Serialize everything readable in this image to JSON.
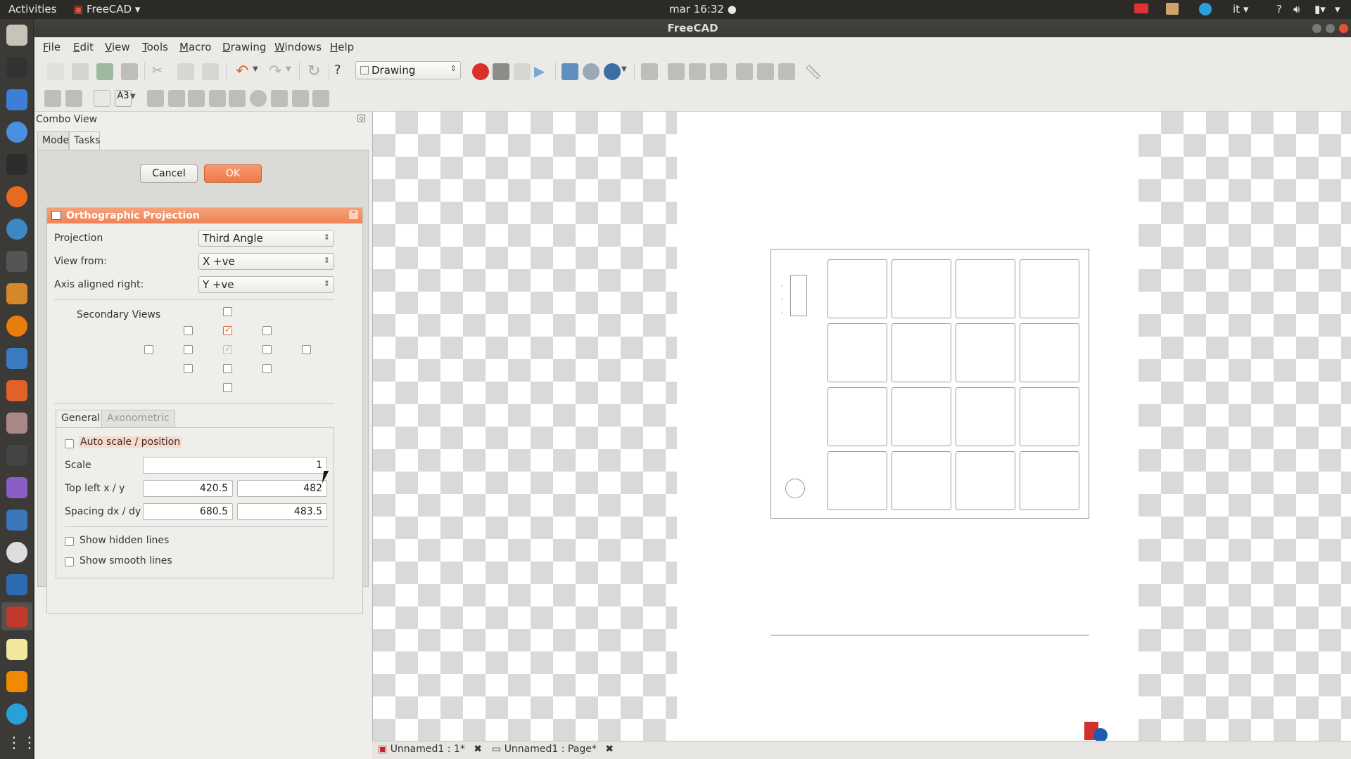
{
  "topbar": {
    "activities": "Activities",
    "app_name": "FreeCAD",
    "clock": "mar 16:32",
    "language": "it",
    "help": "?"
  },
  "window": {
    "title": "FreeCAD"
  },
  "menubar": {
    "items": [
      "File",
      "Edit",
      "View",
      "Tools",
      "Macro",
      "Drawing",
      "Windows",
      "Help"
    ]
  },
  "toolbar": {
    "workbench": "Drawing"
  },
  "combo_view": {
    "title": "Combo View",
    "tabs": [
      "Model",
      "Tasks"
    ],
    "active_tab": "Tasks",
    "cancel_label": "Cancel",
    "ok_label": "OK"
  },
  "ortho": {
    "title": "Orthographic Projection",
    "projection_label": "Projection",
    "projection_value": "Third Angle",
    "view_from_label": "View from:",
    "view_from_value": "X +ve",
    "axis_label": "Axis aligned right:",
    "axis_value": "Y +ve",
    "secondary_views_label": "Secondary Views",
    "subtabs": [
      "General",
      "Axonometric"
    ],
    "auto_scale_label": "Auto scale / position",
    "scale_label": "Scale",
    "scale_value": "1",
    "top_left_label": "Top left x / y",
    "top_left_x": "420.5",
    "top_left_y": "482",
    "spacing_label": "Spacing dx / dy",
    "spacing_dx": "680.5",
    "spacing_dy": "483.5",
    "show_hidden_label": "Show hidden lines",
    "show_smooth_label": "Show smooth lines"
  },
  "doc_tabs": {
    "tab1": "Unnamed1 : 1*",
    "tab2": "Unnamed1 : Page*"
  },
  "colors": {
    "accent": "#f08254",
    "topbar": "#2b2a27",
    "launcher": "#3b3a37"
  }
}
